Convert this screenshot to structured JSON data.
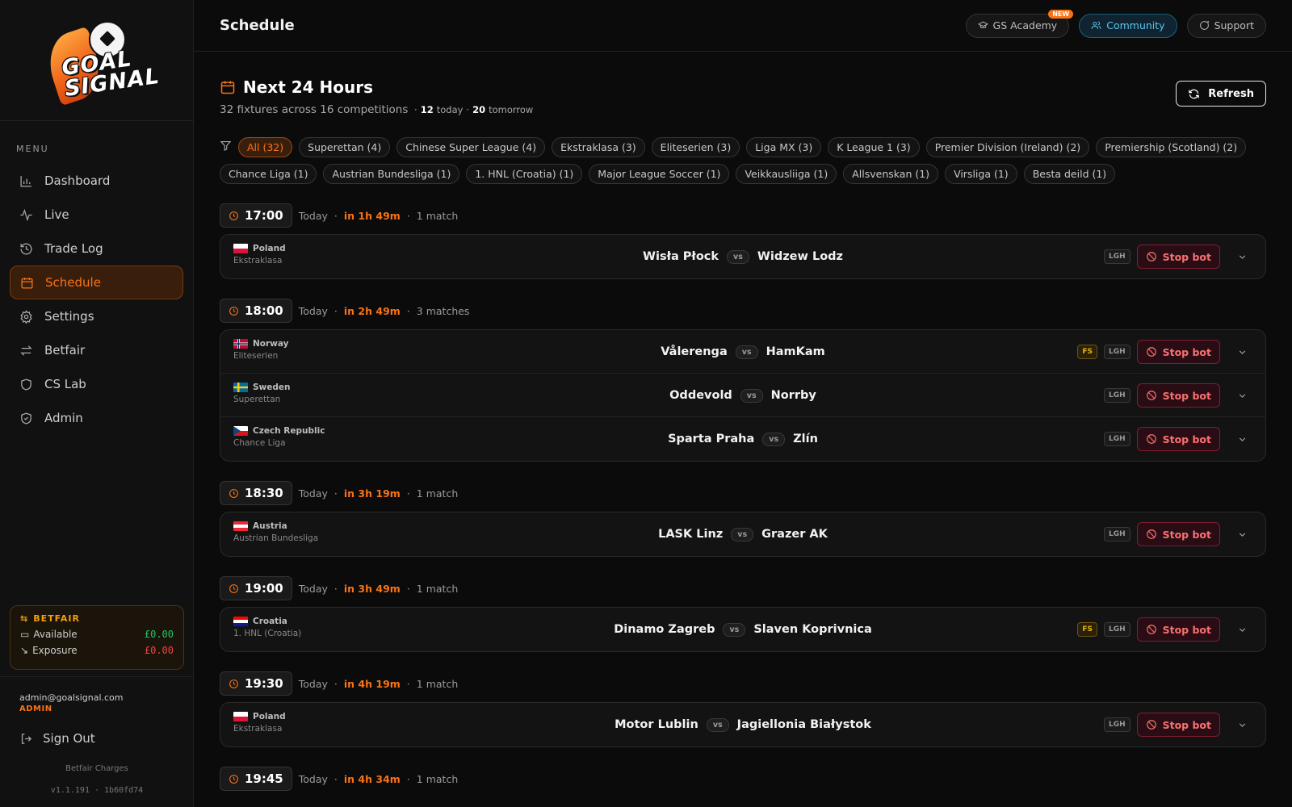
{
  "brand": {
    "logo_text_1": "GOAL",
    "logo_text_2": "SIGNAL"
  },
  "sidebar": {
    "menu_title": "MENU",
    "items": [
      {
        "label": "Dashboard",
        "icon": "bar-chart-icon"
      },
      {
        "label": "Live",
        "icon": "activity-icon"
      },
      {
        "label": "Trade Log",
        "icon": "history-icon"
      },
      {
        "label": "Schedule",
        "icon": "calendar-icon",
        "active": true
      },
      {
        "label": "Settings",
        "icon": "gear-icon"
      },
      {
        "label": "Betfair",
        "icon": "arrows-exchange-icon"
      },
      {
        "label": "CS Lab",
        "icon": "shield-icon"
      },
      {
        "label": "Admin",
        "icon": "shield-check-icon"
      }
    ],
    "betfair": {
      "title": "BETFAIR",
      "available_label": "Available",
      "available_value": "£0.00",
      "exposure_label": "Exposure",
      "exposure_value": "£0.00"
    },
    "user": {
      "email": "admin@goalsignal.com",
      "role": "ADMIN"
    },
    "signout": "Sign Out",
    "charges": "Betfair Charges",
    "version": "v1.1.191 · 1b60fd74"
  },
  "topbar": {
    "title": "Schedule",
    "academy": "GS Academy",
    "new_badge": "NEW",
    "community": "Community",
    "support": "Support"
  },
  "header": {
    "title": "Next 24 Hours",
    "fixtures_summary": "32 fixtures across 16 competitions",
    "today_count": "12",
    "today_label": "today",
    "tomorrow_count": "20",
    "tomorrow_label": "tomorrow",
    "refresh": "Refresh"
  },
  "filters": [
    "All (32)",
    "Superettan (4)",
    "Chinese Super League (4)",
    "Ekstraklasa (3)",
    "Eliteserien (3)",
    "Liga MX (3)",
    "K League 1 (3)",
    "Premier Division (Ireland) (2)",
    "Premiership (Scotland) (2)",
    "Chance Liga (1)",
    "Austrian Bundesliga (1)",
    "1. HNL (Croatia) (1)",
    "Major League Soccer (1)",
    "Veikkausliiga (1)",
    "Allsvenskan (1)",
    "Virsliga (1)",
    "Besta deild (1)"
  ],
  "groups": [
    {
      "time": "17:00",
      "day": "Today",
      "countdown": "in 1h 49m",
      "count": "1 match",
      "matches": [
        {
          "country": "Poland",
          "comp": "Ekstraklasa",
          "home": "Wisła Płock",
          "away": "Widzew Lodz",
          "fs": false
        }
      ]
    },
    {
      "time": "18:00",
      "day": "Today",
      "countdown": "in 2h 49m",
      "count": "3 matches",
      "matches": [
        {
          "country": "Norway",
          "comp": "Eliteserien",
          "home": "Vålerenga",
          "away": "HamKam",
          "fs": true
        },
        {
          "country": "Sweden",
          "comp": "Superettan",
          "home": "Oddevold",
          "away": "Norrby",
          "fs": false
        },
        {
          "country": "Czech Republic",
          "comp": "Chance Liga",
          "home": "Sparta Praha",
          "away": "Zlín",
          "fs": false
        }
      ]
    },
    {
      "time": "18:30",
      "day": "Today",
      "countdown": "in 3h 19m",
      "count": "1 match",
      "matches": [
        {
          "country": "Austria",
          "comp": "Austrian Bundesliga",
          "home": "LASK Linz",
          "away": "Grazer AK",
          "fs": false
        }
      ]
    },
    {
      "time": "19:00",
      "day": "Today",
      "countdown": "in 3h 49m",
      "count": "1 match",
      "matches": [
        {
          "country": "Croatia",
          "comp": "1. HNL (Croatia)",
          "home": "Dinamo Zagreb",
          "away": "Slaven Koprivnica",
          "fs": true
        }
      ]
    },
    {
      "time": "19:30",
      "day": "Today",
      "countdown": "in 4h 19m",
      "count": "1 match",
      "matches": [
        {
          "country": "Poland",
          "comp": "Ekstraklasa",
          "home": "Motor Lublin",
          "away": "Jagiellonia Białystok",
          "fs": false
        }
      ]
    },
    {
      "time": "19:45",
      "day": "Today",
      "countdown": "in 4h 34m",
      "count": "1 match",
      "matches": []
    }
  ],
  "labels": {
    "vs": "vs",
    "fs": "FS",
    "lgh": "LGH",
    "stop": "Stop bot"
  },
  "colors": {
    "accent": "#f97316",
    "danger": "#f87171",
    "success": "#22c55e",
    "warning": "#eab308"
  }
}
